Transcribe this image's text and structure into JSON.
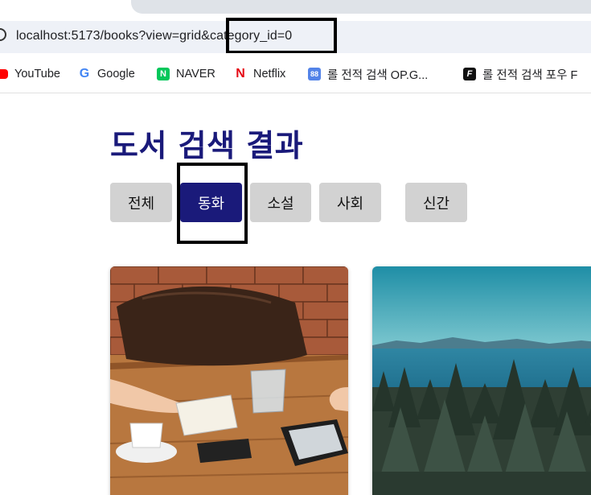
{
  "browser": {
    "url": "localhost:5173/books?view=grid&category_id=0",
    "bookmarks": [
      {
        "label": "YouTube",
        "icon": "youtube-icon"
      },
      {
        "label": "Google",
        "icon": "google-icon"
      },
      {
        "label": "NAVER",
        "icon": "naver-icon"
      },
      {
        "label": "Netflix",
        "icon": "netflix-icon"
      },
      {
        "label": "롤 전적 검색 OP.G...",
        "icon": "opgg-icon"
      },
      {
        "label": "롤 전적 검색 포우 F",
        "icon": "fow-icon"
      }
    ]
  },
  "page": {
    "title": "도서 검색 결과",
    "categories": [
      {
        "label": "전체",
        "active": false
      },
      {
        "label": "동화",
        "active": true
      },
      {
        "label": "소설",
        "active": false
      },
      {
        "label": "사회",
        "active": false
      },
      {
        "label": "신간",
        "active": false
      }
    ]
  },
  "colors": {
    "accent": "#1a1a7a",
    "category_bg": "#d2d2d2",
    "highlight_border": "#000000"
  }
}
